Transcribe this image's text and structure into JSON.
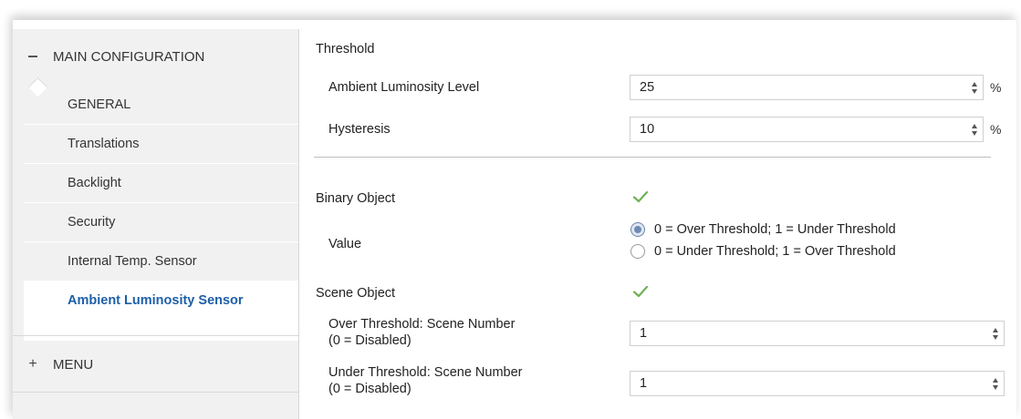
{
  "sidebar": {
    "main_config": {
      "sign": "−",
      "label": "MAIN CONFIGURATION"
    },
    "items": [
      {
        "label": "GENERAL"
      },
      {
        "label": "Translations"
      },
      {
        "label": "Backlight"
      },
      {
        "label": "Security"
      },
      {
        "label": "Internal Temp. Sensor"
      },
      {
        "label": "Ambient Luminosity Sensor",
        "active": true
      }
    ],
    "menu": {
      "sign": "+",
      "label": "MENU"
    }
  },
  "main": {
    "threshold_heading": "Threshold",
    "ambient_level": {
      "label": "Ambient Luminosity Level",
      "value": "25",
      "unit": "%"
    },
    "hysteresis": {
      "label": "Hysteresis",
      "value": "10",
      "unit": "%"
    },
    "binary_object": {
      "label": "Binary Object",
      "checked": true
    },
    "value": {
      "label": "Value",
      "options": [
        {
          "label": "0 = Over Threshold; 1 = Under Threshold",
          "selected": true
        },
        {
          "label": "0 = Under Threshold; 1 = Over Threshold",
          "selected": false
        }
      ]
    },
    "scene_object": {
      "label": "Scene Object",
      "checked": true
    },
    "over_scene": {
      "label_line1": "Over Threshold: Scene Number",
      "label_line2": "(0 = Disabled)",
      "value": "1"
    },
    "under_scene": {
      "label_line1": "Under Threshold: Scene Number",
      "label_line2": "(0 = Disabled)",
      "value": "1"
    }
  },
  "colors": {
    "accent": "#1d5fa8",
    "check_green": "#6fb256",
    "sidebar_bg": "#f1f1f1"
  }
}
